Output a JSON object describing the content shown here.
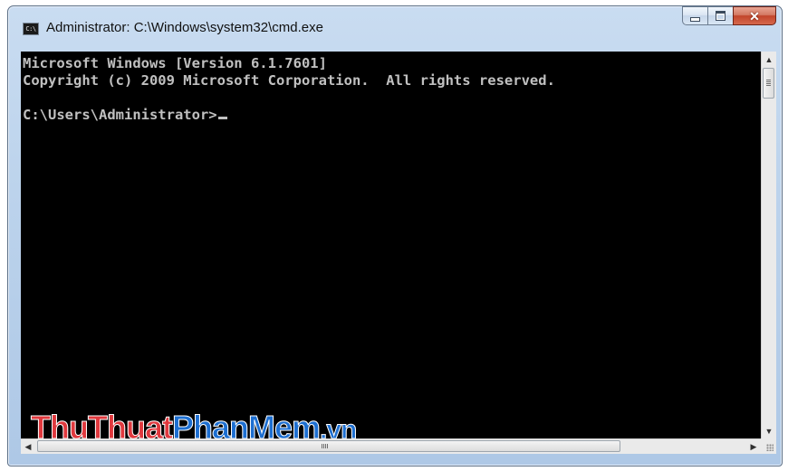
{
  "window": {
    "title": "Administrator: C:\\Windows\\system32\\cmd.exe",
    "icon_label": "C:\\",
    "icon": "cmd-icon",
    "buttons": {
      "minimize_icon": "minimize-icon",
      "maximize_icon": "maximize-icon",
      "close_icon": "close-icon",
      "close_glyph": "✕"
    }
  },
  "console": {
    "lines": [
      "Microsoft Windows [Version 6.1.7601]",
      "Copyright (c) 2009 Microsoft Corporation.  All rights reserved."
    ],
    "prompt": "C:\\Users\\Administrator>",
    "background": "#000000",
    "foreground": "#c0c0c0"
  },
  "scrollbars": {
    "up_arrow": "▲",
    "down_arrow": "▼",
    "left_arrow": "◀",
    "right_arrow": "▶"
  },
  "watermark": {
    "part1": "ThuThuat",
    "part2": "PhanMem",
    "part3": ".vn",
    "color1": "#e0393e",
    "color2": "#1d6fd1"
  }
}
